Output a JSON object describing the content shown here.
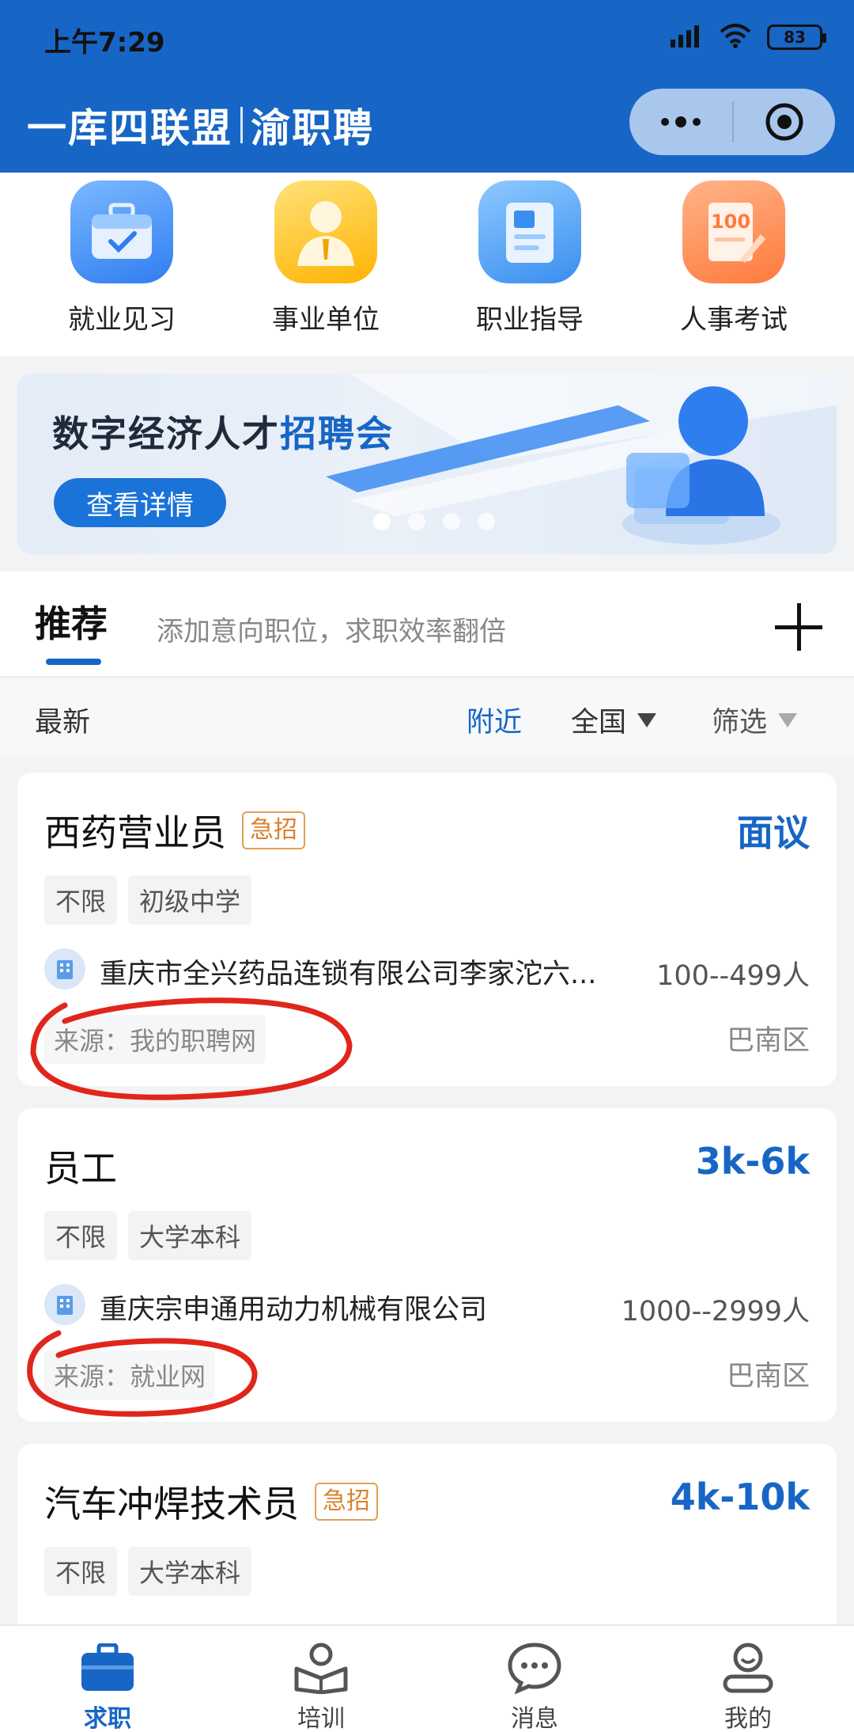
{
  "status_bar": {
    "time": "上午7:29",
    "battery": "83"
  },
  "header": {
    "title_left": "一库四联盟",
    "title_right": "渝职聘"
  },
  "quick_entries": [
    {
      "label": "就业见习",
      "icon": "briefcase-icon"
    },
    {
      "label": "事业单位",
      "icon": "person-icon"
    },
    {
      "label": "职业指导",
      "icon": "book-icon"
    },
    {
      "label": "人事考试",
      "icon": "exam-paper-icon"
    }
  ],
  "banner": {
    "title_prefix": "数字经济人才",
    "title_highlight": "招聘会",
    "button": "查看详情"
  },
  "tabs": {
    "active": "推荐",
    "hint": "添加意向职位，求职效率翻倍"
  },
  "filters": {
    "latest": "最新",
    "nearby": "附近",
    "country": "全国",
    "screen": "筛选"
  },
  "jobs": [
    {
      "title": "西药营业员",
      "urgent": "急招",
      "salary": "面议",
      "tags": [
        "不限",
        "初级中学"
      ],
      "company": "重庆市全兴药品连锁有限公司李家沱六...",
      "size": "100--499人",
      "source": "来源：我的职聘网",
      "district": "巴南区"
    },
    {
      "title": "员工",
      "salary": "3k-6k",
      "tags": [
        "不限",
        "大学本科"
      ],
      "company": "重庆宗申通用动力机械有限公司",
      "size": "1000--2999人",
      "source": "来源：就业网",
      "district": "巴南区"
    },
    {
      "title": "汽车冲焊技术员",
      "urgent": "急招",
      "salary": "4k-10k",
      "tags": [
        "不限",
        "大学本科"
      ]
    }
  ],
  "bottom_nav": [
    {
      "label": "求职",
      "icon": "briefcase-icon",
      "active": true
    },
    {
      "label": "培训",
      "icon": "training-icon",
      "active": false
    },
    {
      "label": "消息",
      "icon": "message-icon",
      "active": false
    },
    {
      "label": "我的",
      "icon": "profile-icon",
      "active": false
    }
  ],
  "colors": {
    "brand": "#1766c6",
    "urgent": "#d9822b",
    "annotation": "#e0261c"
  }
}
